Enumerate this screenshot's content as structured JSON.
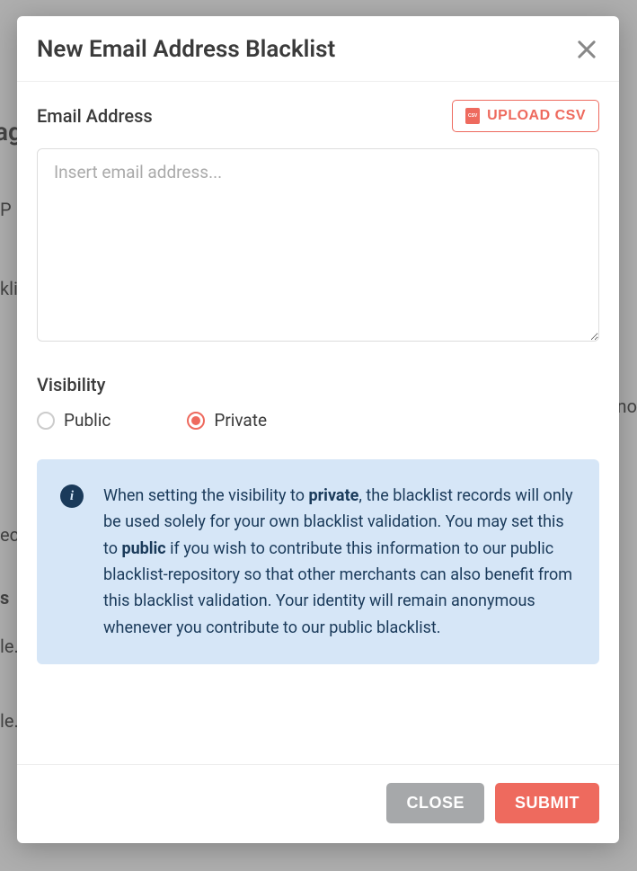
{
  "modal": {
    "title": "New Email Address Blacklist",
    "email_label": "Email Address",
    "upload_btn": "UPLOAD CSV",
    "email_placeholder": "Insert email address...",
    "email_value": "",
    "visibility_label": "Visibility",
    "visibility_options": {
      "public": "Public",
      "private": "Private"
    },
    "visibility_selected": "private",
    "info": {
      "pre": "When setting the visibility to ",
      "kw1": "private",
      "mid1": ", the blacklist records will only be used solely for your own blacklist validation. You may set this to ",
      "kw2": "public",
      "mid2": " if you wish to contribute this information to our public blacklist-repository so that other merchants can also benefit from this blacklist validation. Your identity will remain anonymous whenever you contribute to our public blacklist."
    },
    "close_btn": "CLOSE",
    "submit_btn": "SUBMIT"
  },
  "colors": {
    "accent": "#ee6a5e",
    "info_bg": "#d6e6f7",
    "info_fg": "#1a3a5a"
  }
}
